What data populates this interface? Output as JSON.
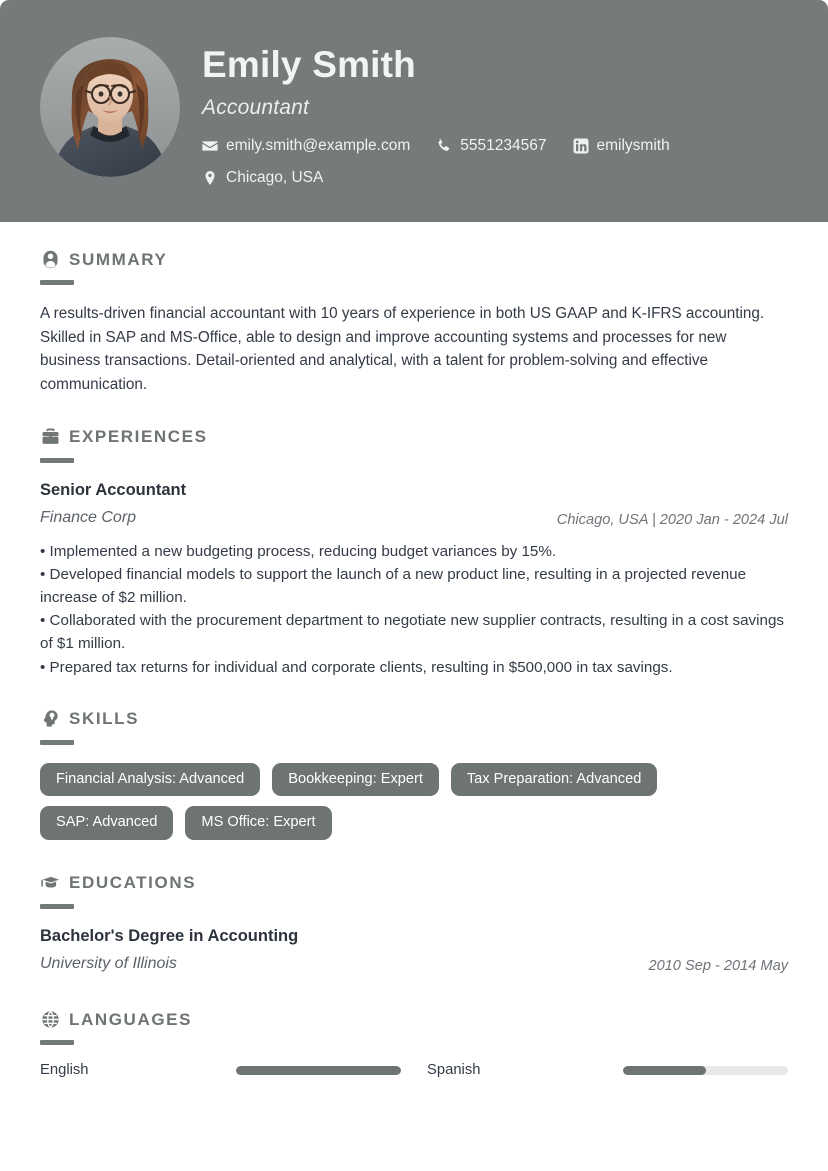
{
  "header": {
    "name": "Emily Smith",
    "job_title": "Accountant",
    "avatar_alt": "profile-photo",
    "contacts": [
      {
        "icon": "envelope-icon",
        "value": "emily.smith@example.com"
      },
      {
        "icon": "phone-icon",
        "value": "5551234567"
      },
      {
        "icon": "linkedin-icon",
        "value": "emilysmith"
      },
      {
        "icon": "location-pin-icon",
        "value": "Chicago, USA"
      }
    ]
  },
  "sections": {
    "summary": {
      "title": "SUMMARY",
      "icon": "user-circle-icon",
      "text": "A results-driven financial accountant with 10 years of experience in both US GAAP and K-IFRS accounting. Skilled in SAP and MS-Office, able to design and improve accounting systems and processes for new business transactions. Detail-oriented and analytical, with a talent for problem-solving and effective communication."
    },
    "experiences": {
      "title": "EXPERIENCES",
      "icon": "briefcase-icon",
      "items": [
        {
          "role": "Senior Accountant",
          "company": "Finance Corp",
          "meta": "Chicago, USA  |  2020 Jan - 2024 Jul",
          "bullets": [
            "• Implemented a new budgeting process, reducing budget variances by 15%.",
            "• Developed financial models to support the launch of a new product line, resulting in a projected revenue increase of $2 million.",
            "• Collaborated with the procurement department to negotiate new supplier contracts, resulting in a cost savings of $1 million.",
            "• Prepared tax returns for individual and corporate clients, resulting in $500,000 in tax savings."
          ]
        }
      ]
    },
    "skills": {
      "title": "SKILLS",
      "icon": "head-lightbulb-icon",
      "tags": [
        "Financial Analysis: Advanced",
        "Bookkeeping: Expert",
        "Tax Preparation: Advanced",
        "SAP: Advanced",
        "MS Office: Expert"
      ]
    },
    "educations": {
      "title": "EDUCATIONS",
      "icon": "graduation-cap-icon",
      "items": [
        {
          "degree": "Bachelor's Degree in Accounting",
          "school": "University of Illinois",
          "meta": "2010 Sep - 2014 May"
        }
      ]
    },
    "languages": {
      "title": "LANGUAGES",
      "icon": "globe-icon",
      "items": [
        {
          "name": "English",
          "level_percent": 100
        },
        {
          "name": "Spanish",
          "level_percent": 50
        }
      ]
    }
  },
  "theme": {
    "header_bg": "#767a7a",
    "accent_gray": "#6e7373",
    "heading_gray": "#6e7373",
    "body_text": "#343b46",
    "track_gray": "#e8eae8"
  }
}
